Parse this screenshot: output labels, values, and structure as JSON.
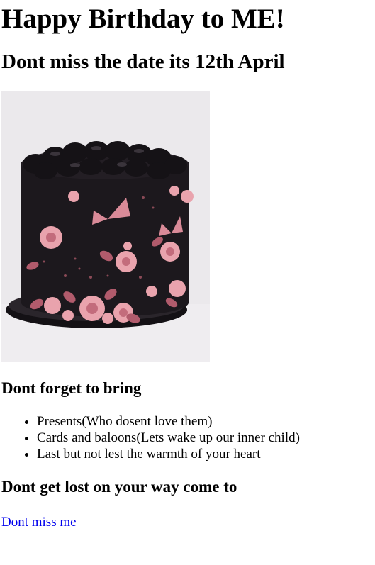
{
  "header": {
    "title": "Happy Birthday to ME!",
    "subtitle": "Dont miss the date its 12th April"
  },
  "bring": {
    "heading": "Dont forget to bring",
    "items": [
      "Presents(Who dosent love them)",
      "Cards and baloons(Lets wake up our inner child)",
      "Last but not lest the warmth of your heart"
    ]
  },
  "directions": {
    "heading": "Dont get lost on your way come to",
    "link_text": "Dont miss me"
  },
  "colors": {
    "link": "#0000ee",
    "cake_body": "#1c181d",
    "flowers": "#e9a3ad"
  }
}
